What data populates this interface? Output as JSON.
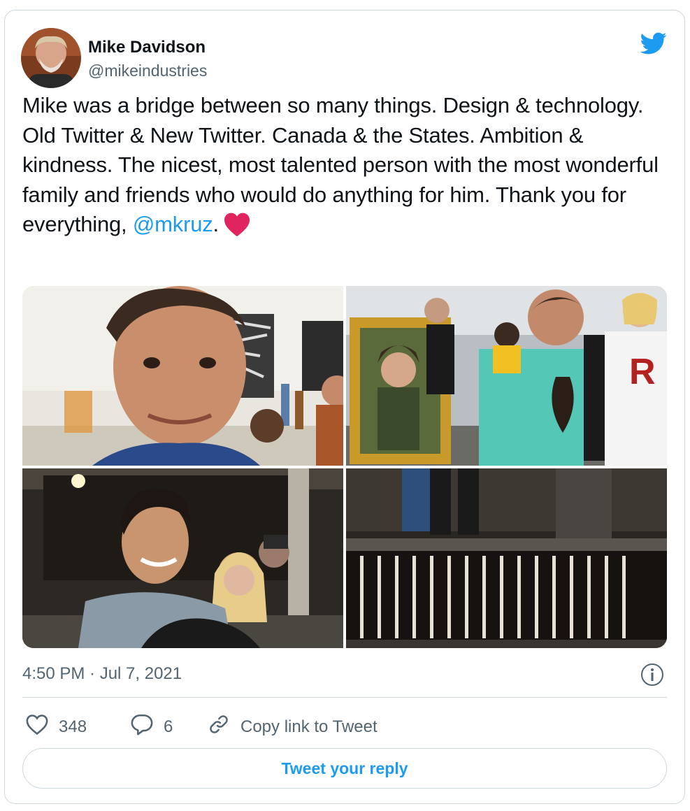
{
  "author": {
    "name": "Mike Davidson",
    "handle": "@mikeindustries"
  },
  "tweet": {
    "text": "Mike was a bridge between so many things. Design & technology. Old Twitter & New Twitter. Canada & the States. Ambition & kindness. The nicest, most talented person with the most wonderful family and friends who would do anything for him. Thank you for everything,",
    "mention": "@mkruz",
    "after_mention": ".",
    "emoji": "red-heart"
  },
  "media": [
    {
      "alt_icon": "photo-selfie-office"
    },
    {
      "alt_icon": "photo-costume-party"
    },
    {
      "alt_icon": "photo-bus-selfie"
    },
    {
      "alt_icon": "photo-stage-curtain"
    }
  ],
  "timestamp": "4:50 PM · Jul 7, 2021",
  "actions": {
    "likes": "348",
    "replies": "6",
    "copy_link": "Copy link to Tweet"
  },
  "reply_button": "Tweet your reply",
  "colors": {
    "accent": "#1d9bf0",
    "secondary_text": "#536471",
    "border": "#cfd9de",
    "heart": "#e0245e"
  },
  "icons": [
    "twitter-bird-icon",
    "info-icon",
    "heart-outline-icon",
    "reply-bubble-icon",
    "link-icon"
  ]
}
